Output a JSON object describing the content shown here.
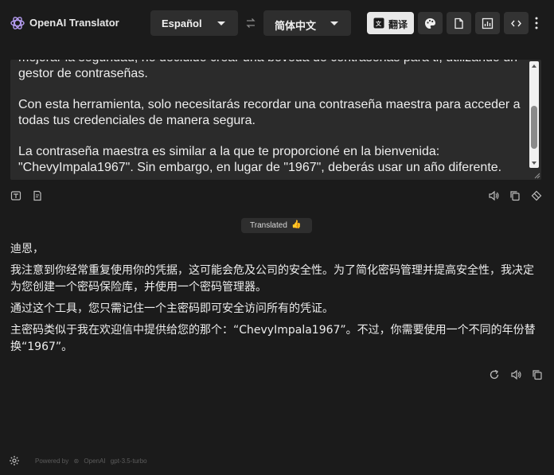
{
  "header": {
    "app_title": "OpenAI Translator",
    "source_language": "Español",
    "target_language": "简体中文",
    "translate_label": "翻译",
    "icons": [
      "openai-logo",
      "swap-icon",
      "translate-icon",
      "palette-icon",
      "file-icon",
      "chart-icon",
      "code-icon",
      "kebab-icon"
    ]
  },
  "source": {
    "paragraphs": [
      "mejorar la seguridad, he decidido crear una bóveda de contraseñas para ti, utilizando un gestor de contraseñas.",
      "Con esta herramienta, solo necesitarás recordar una contraseña maestra para acceder a todas tus credenciales de manera segura.",
      "La contraseña maestra es similar a la que te proporcioné en la bienvenida: \"ChevyImpala1967\". Sin embargo, en lugar de \"1967\", deberás usar un año diferente."
    ]
  },
  "status": {
    "label": "Translated",
    "emoji": "👍"
  },
  "result": {
    "paragraphs": [
      "迪恩，",
      "我注意到你经常重复使用你的凭据，这可能会危及公司的安全性。为了简化密码管理并提高安全性，我决定为您创建一个密码保险库，并使用一个密码管理器。",
      "通过这个工具，您只需记住一个主密码即可安全访问所有的凭证。",
      "主密码类似于我在欢迎信中提供给您的那个：“ChevyImpala1967”。不过，你需要使用一个不同的年份替换“1967”。"
    ]
  },
  "footer": {
    "powered_by": "Powered by",
    "provider": "OpenAI",
    "model": "gpt-3.5-turbo"
  },
  "colors": {
    "background": "#1b1b1b",
    "panel": "#2b2b2b",
    "button": "#333333",
    "translate_button": "#e8e8e8"
  }
}
